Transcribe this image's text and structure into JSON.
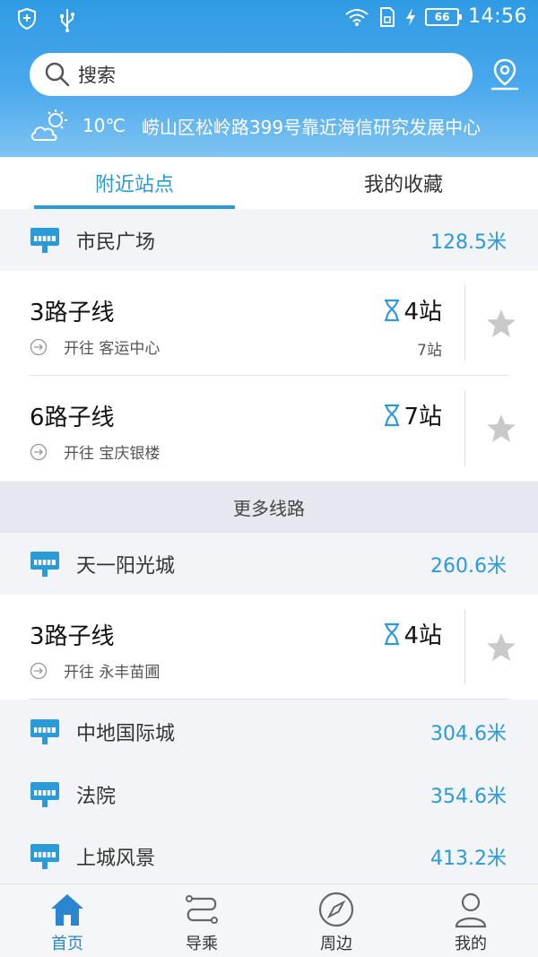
{
  "status_bar": {
    "battery": "66",
    "time": "14:56"
  },
  "search": {
    "placeholder": "搜索"
  },
  "weather": {
    "temperature": "10℃",
    "address": "崂山区松岭路399号靠近海信研究发展中心"
  },
  "tabs": [
    {
      "label": "附近站点",
      "active": true
    },
    {
      "label": "我的收藏",
      "active": false
    }
  ],
  "stations": [
    {
      "name": "市民广场",
      "distance": "128.5米",
      "routes": [
        {
          "name": "3路子线",
          "direction": "开往 客运中心",
          "eta": "4站",
          "stops": "7站"
        },
        {
          "name": "6路子线",
          "direction": "开往 宝庆银楼",
          "eta": "7站",
          "stops": ""
        }
      ]
    },
    {
      "name": "天一阳光城",
      "distance": "260.6米",
      "routes": [
        {
          "name": "3路子线",
          "direction": "开往 永丰苗圃",
          "eta": "4站",
          "stops": ""
        }
      ]
    },
    {
      "name": "中地国际城",
      "distance": "304.6米",
      "routes": []
    },
    {
      "name": "法院",
      "distance": "354.6米",
      "routes": []
    },
    {
      "name": "上城风景",
      "distance": "413.2米",
      "routes": []
    }
  ],
  "more_routes_label": "更多线路",
  "bottom_nav": [
    {
      "label": "首页",
      "icon": "home-icon",
      "active": true
    },
    {
      "label": "导乘",
      "icon": "route-icon",
      "active": false
    },
    {
      "label": "周边",
      "icon": "compass-icon",
      "active": false
    },
    {
      "label": "我的",
      "icon": "user-icon",
      "active": false
    }
  ],
  "colors": {
    "accent": "#2b9ad9",
    "header_top": "#2f9be3",
    "header_bottom": "#7fc3f2"
  }
}
